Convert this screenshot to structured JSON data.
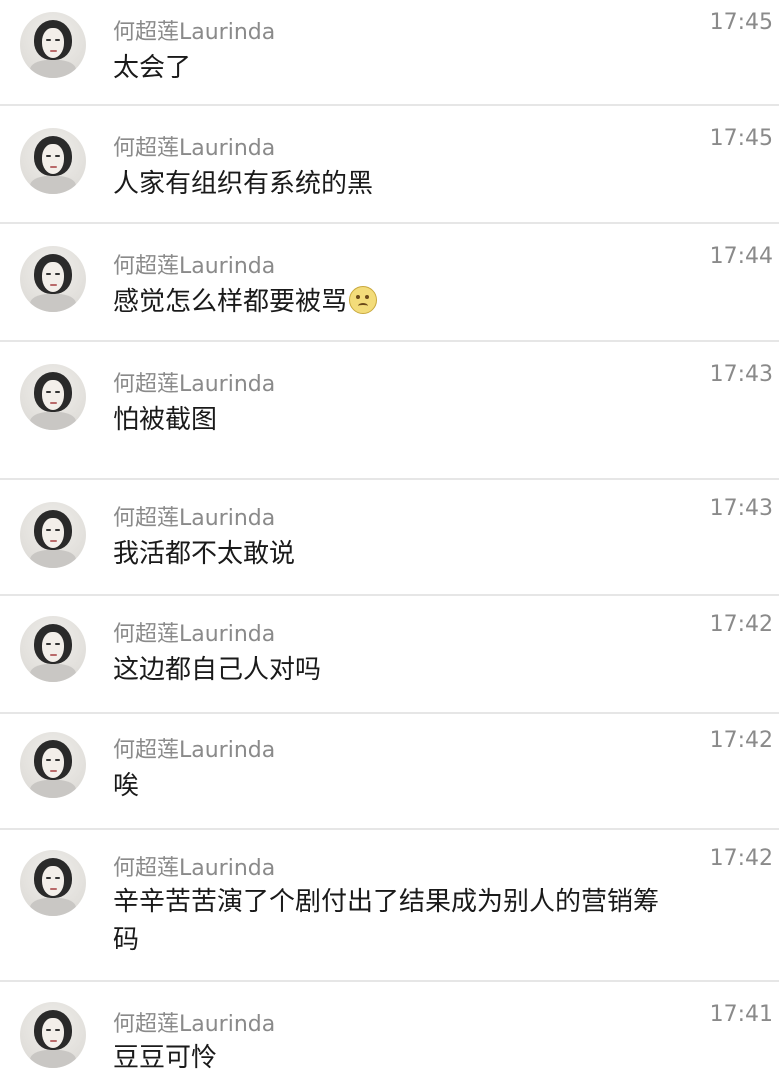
{
  "messages": [
    {
      "name": "何超莲Laurinda",
      "time": "17:45",
      "text": "太会了",
      "avatar_icon": "user-avatar"
    },
    {
      "name": "何超莲Laurinda",
      "time": "17:45",
      "text": "人家有组织有系统的黑",
      "avatar_icon": "user-avatar"
    },
    {
      "name": "何超莲Laurinda",
      "time": "17:44",
      "text": "感觉怎么样都要被骂",
      "emoji_icon": "sad-face-emoji",
      "avatar_icon": "user-avatar"
    },
    {
      "name": "何超莲Laurinda",
      "time": "17:43",
      "text": "怕被截图",
      "avatar_icon": "user-avatar"
    },
    {
      "name": "何超莲Laurinda",
      "time": "17:43",
      "text": "我活都不太敢说",
      "avatar_icon": "user-avatar"
    },
    {
      "name": "何超莲Laurinda",
      "time": "17:42",
      "text": "这边都自己人对吗",
      "avatar_icon": "user-avatar"
    },
    {
      "name": "何超莲Laurinda",
      "time": "17:42",
      "text": "唉",
      "avatar_icon": "user-avatar"
    },
    {
      "name": "何超莲Laurinda",
      "time": "17:42",
      "text": "辛辛苦苦演了个剧付出了结果成为别人的营销筹码",
      "avatar_icon": "user-avatar"
    },
    {
      "name": "何超莲Laurinda",
      "time": "17:41",
      "text": "豆豆可怜",
      "avatar_icon": "user-avatar"
    }
  ]
}
